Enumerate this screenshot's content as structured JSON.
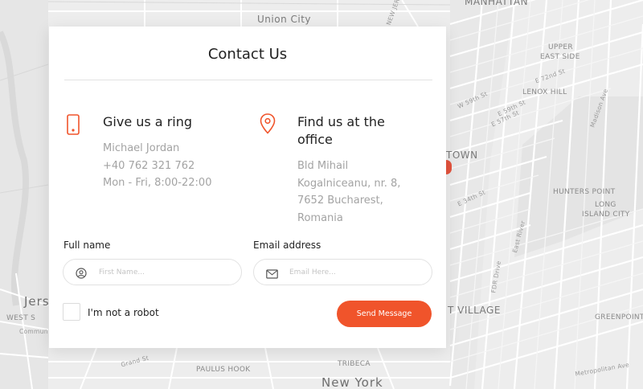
{
  "map": {
    "labels": {
      "union_city": "Union City",
      "manhattan": "MANHATTAN",
      "upper_east_side_1": "UPPER",
      "upper_east_side_2": "EAST SIDE",
      "lenox_hill": "LENOX HILL",
      "midtown": "TOWN",
      "hunters_point": "HUNTERS POINT",
      "long_island_city_1": "LONG",
      "long_island_city_2": "ISLAND CITY",
      "east_village": "T VILLAGE",
      "greenpoint": "GREENPOINT",
      "tribeca": "TRIBECA",
      "paulus_hook": "PAULUS HOOK",
      "new_york": "New York",
      "jersey": "Jers",
      "west_side": "WEST S",
      "community": "Commun",
      "new_jersey": "NEW JERS",
      "st_e72": "E 72nd St",
      "st_w59": "W 59th St",
      "st_e59": "E 59th St",
      "st_e57": "E 57th St",
      "st_e34": "E 34th St",
      "east_river": "East River",
      "fdr_drive": "FDR Drive",
      "metropolitan": "Metropolitan Ave",
      "grand_st": "Grand St",
      "madison_ave": "Madison Ave"
    }
  },
  "card": {
    "title": "Contact Us",
    "phone": {
      "heading": "Give us a ring",
      "lines": [
        "Michael Jordan",
        "+40 762 321 762",
        "Mon - Fri, 8:00-22:00"
      ],
      "icon": "phone-icon"
    },
    "office": {
      "heading_line1": "Find us at the",
      "heading_line2": "office",
      "lines": [
        "Bld Mihail",
        "Kogalniceanu, nr. 8,",
        "7652 Bucharest,",
        "Romania"
      ],
      "icon": "location-pin-icon"
    },
    "form": {
      "full_name_label": "Full name",
      "full_name_placeholder": "First Name...",
      "email_label": "Email address",
      "email_placeholder": "Email Here...",
      "robot_label": "I'm not a robot",
      "submit_label": "Send Message"
    }
  },
  "colors": {
    "accent": "#f0542b",
    "text_dark": "#222222",
    "text_muted": "#a3a3a3",
    "border": "#e2e2e2"
  }
}
